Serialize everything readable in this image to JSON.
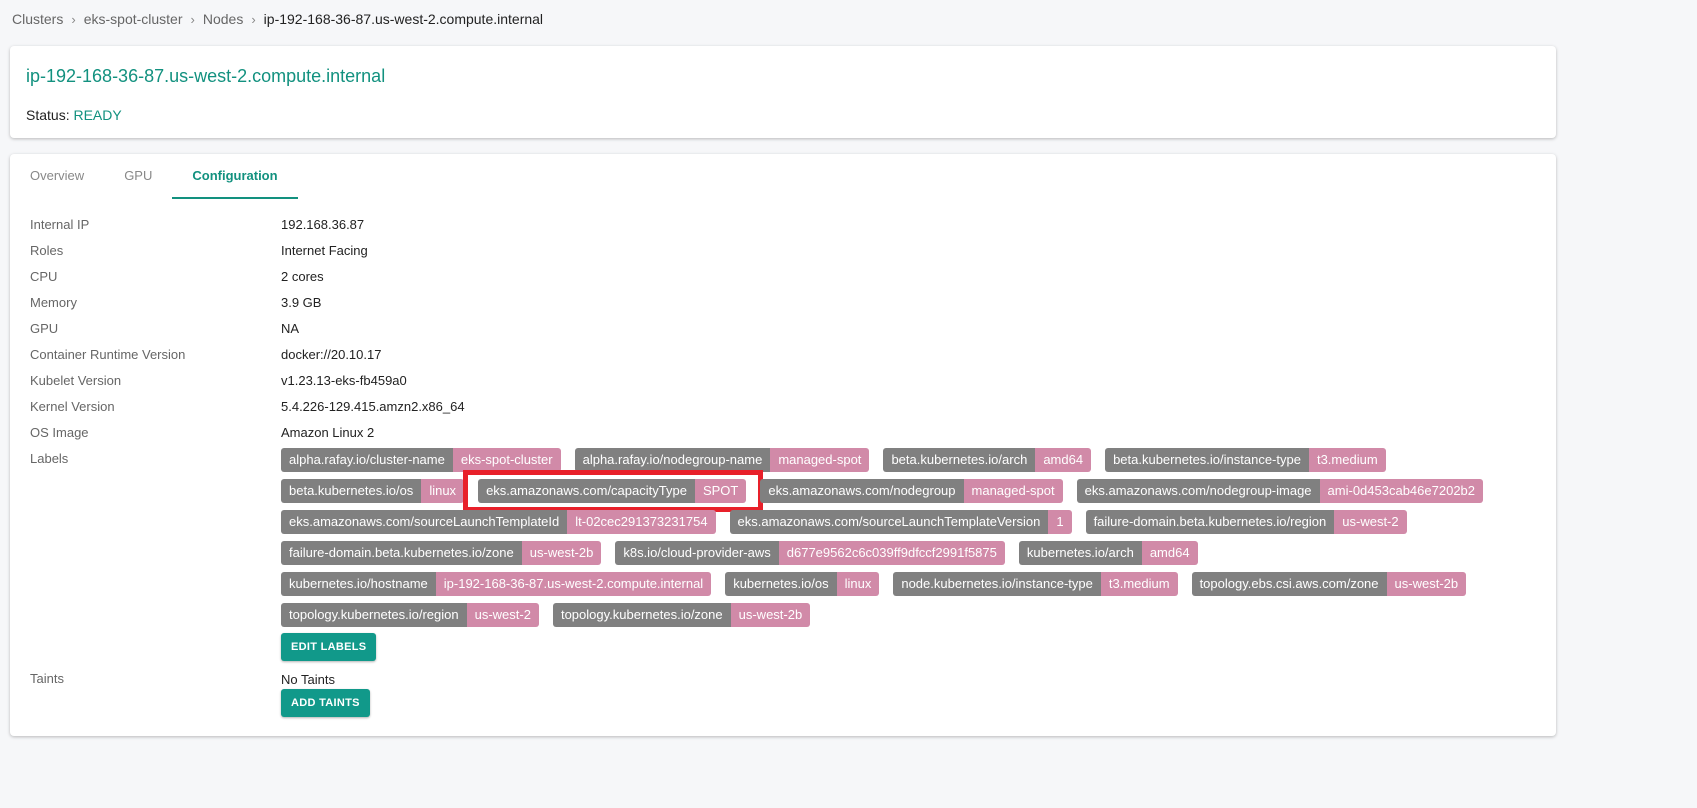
{
  "breadcrumb": [
    "Clusters",
    "eks-spot-cluster",
    "Nodes",
    "ip-192-168-36-87.us-west-2.compute.internal"
  ],
  "header": {
    "title": "ip-192-168-36-87.us-west-2.compute.internal",
    "status_label": "Status:",
    "status_value": "READY"
  },
  "tabs": [
    "Overview",
    "GPU",
    "Configuration"
  ],
  "active_tab": "Configuration",
  "properties": [
    {
      "k": "Internal IP",
      "v": "192.168.36.87"
    },
    {
      "k": "Roles",
      "v": "Internet Facing"
    },
    {
      "k": "CPU",
      "v": "2 cores"
    },
    {
      "k": "Memory",
      "v": "3.9 GB"
    },
    {
      "k": "GPU",
      "v": "NA"
    },
    {
      "k": "Container Runtime Version",
      "v": "docker://20.10.17"
    },
    {
      "k": "Kubelet Version",
      "v": "v1.23.13-eks-fb459a0"
    },
    {
      "k": "Kernel Version",
      "v": "5.4.226-129.415.amzn2.x86_64"
    },
    {
      "k": "OS Image",
      "v": "Amazon Linux 2"
    },
    {
      "k": "Labels",
      "v": ""
    }
  ],
  "labels": [
    {
      "k": "alpha.rafay.io/cluster-name",
      "v": "eks-spot-cluster"
    },
    {
      "k": "alpha.rafay.io/nodegroup-name",
      "v": "managed-spot"
    },
    {
      "k": "beta.kubernetes.io/arch",
      "v": "amd64"
    },
    {
      "k": "beta.kubernetes.io/instance-type",
      "v": "t3.medium"
    },
    {
      "k": "beta.kubernetes.io/os",
      "v": "linux"
    },
    {
      "k": "eks.amazonaws.com/capacityType",
      "v": "SPOT",
      "highlighted": true
    },
    {
      "k": "eks.amazonaws.com/nodegroup",
      "v": "managed-spot"
    },
    {
      "k": "eks.amazonaws.com/nodegroup-image",
      "v": "ami-0d453cab46e7202b2"
    },
    {
      "k": "eks.amazonaws.com/sourceLaunchTemplateId",
      "v": "lt-02cec291373231754"
    },
    {
      "k": "eks.amazonaws.com/sourceLaunchTemplateVersion",
      "v": "1"
    },
    {
      "k": "failure-domain.beta.kubernetes.io/region",
      "v": "us-west-2"
    },
    {
      "k": "failure-domain.beta.kubernetes.io/zone",
      "v": "us-west-2b"
    },
    {
      "k": "k8s.io/cloud-provider-aws",
      "v": "d677e9562c6c039ff9dfccf2991f5875"
    },
    {
      "k": "kubernetes.io/arch",
      "v": "amd64"
    },
    {
      "k": "kubernetes.io/hostname",
      "v": "ip-192-168-36-87.us-west-2.compute.internal"
    },
    {
      "k": "kubernetes.io/os",
      "v": "linux"
    },
    {
      "k": "node.kubernetes.io/instance-type",
      "v": "t3.medium"
    },
    {
      "k": "topology.ebs.csi.aws.com/zone",
      "v": "us-west-2b"
    },
    {
      "k": "topology.kubernetes.io/region",
      "v": "us-west-2"
    },
    {
      "k": "topology.kubernetes.io/zone",
      "v": "us-west-2b"
    }
  ],
  "buttons": {
    "edit_labels": "EDIT LABELS",
    "add_taints": "ADD TAINTS"
  },
  "taints": {
    "label": "Taints",
    "value": "No Taints"
  },
  "colors": {
    "accent": "#12917f",
    "label_key": "#808080",
    "label_value": "#d18aa8",
    "highlight": "#e8202a"
  }
}
